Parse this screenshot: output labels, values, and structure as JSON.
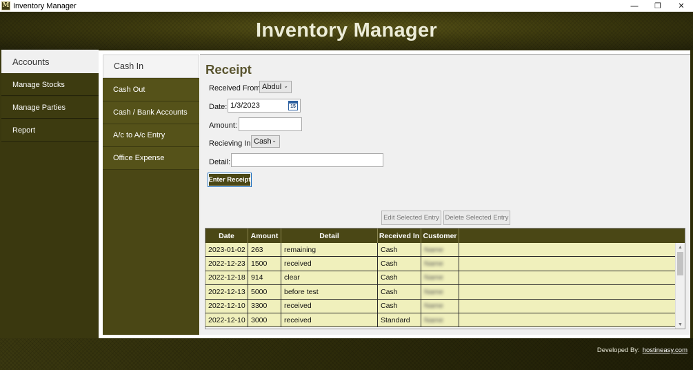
{
  "window": {
    "title": "Inventory Manager",
    "icon_glyph": "M",
    "controls": {
      "minimize": "—",
      "restore": "❐",
      "close": "✕"
    }
  },
  "header": {
    "title": "Inventory Manager"
  },
  "primary_nav": {
    "active": "Accounts",
    "items": [
      "Manage Stocks",
      "Manage Parties",
      "Report"
    ]
  },
  "secondary_nav": {
    "active": "Cash In",
    "items": [
      "Cash Out",
      "Cash / Bank Accounts",
      "A/c to A/c Entry",
      "Office Expense"
    ]
  },
  "form": {
    "title": "Receipt",
    "received_from_label": "Received From:",
    "received_from_value": "Abdul",
    "date_label": "Date:",
    "date_value": "1/3/2023",
    "calendar_glyph": "15",
    "amount_label": "Amount:",
    "amount_value": "",
    "receiving_in_label": "Recieving In:",
    "receiving_in_value": "Cash",
    "detail_label": "Detail:",
    "detail_value": "",
    "enter_button": "Enter Receipt",
    "edit_button": "Edit Selected Entry",
    "delete_button": "Delete Selected Entry"
  },
  "grid": {
    "columns": [
      "Date",
      "Amount",
      "Detail",
      "Received In",
      "Customer"
    ],
    "rows": [
      {
        "date": "2023-01-02",
        "amount": "263",
        "detail": "remaining",
        "received_in": "Cash",
        "customer": "Name"
      },
      {
        "date": "2022-12-23",
        "amount": "1500",
        "detail": "received",
        "received_in": "Cash",
        "customer": "Name"
      },
      {
        "date": "2022-12-18",
        "amount": "914",
        "detail": "clear",
        "received_in": "Cash",
        "customer": "Name"
      },
      {
        "date": "2022-12-13",
        "amount": "5000",
        "detail": "before test",
        "received_in": "Cash",
        "customer": "Name"
      },
      {
        "date": "2022-12-10",
        "amount": "3300",
        "detail": "received",
        "received_in": "Cash",
        "customer": "Name"
      },
      {
        "date": "2022-12-10",
        "amount": "3000",
        "detail": "received",
        "received_in": "Standard",
        "customer": "Name"
      }
    ]
  },
  "footer": {
    "developed_by": "Developed By:",
    "link": "hostineasy.com"
  },
  "colors": {
    "brand_dark": "#3a380f",
    "header_row": "#4a4715",
    "grid_row": "#f0f0bc"
  }
}
